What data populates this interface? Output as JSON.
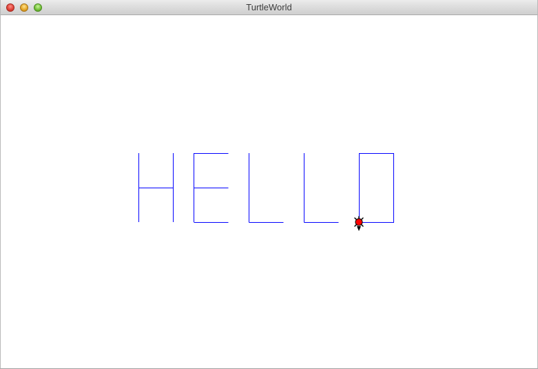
{
  "window": {
    "title": "TurtleWorld",
    "controls": [
      {
        "name": "close",
        "icon": "close-icon",
        "color": "#e0443a"
      },
      {
        "name": "minimize",
        "icon": "minimize-icon",
        "color": "#e6a92a"
      },
      {
        "name": "zoom",
        "icon": "zoom-icon",
        "color": "#76c23b"
      }
    ]
  },
  "canvas": {
    "background": "#ffffff",
    "pen_color": "#0000ff",
    "turtle": {
      "icon": "turtle-icon",
      "body_color": "#ff0000",
      "outline_color": "#000000",
      "heading": "down"
    }
  }
}
